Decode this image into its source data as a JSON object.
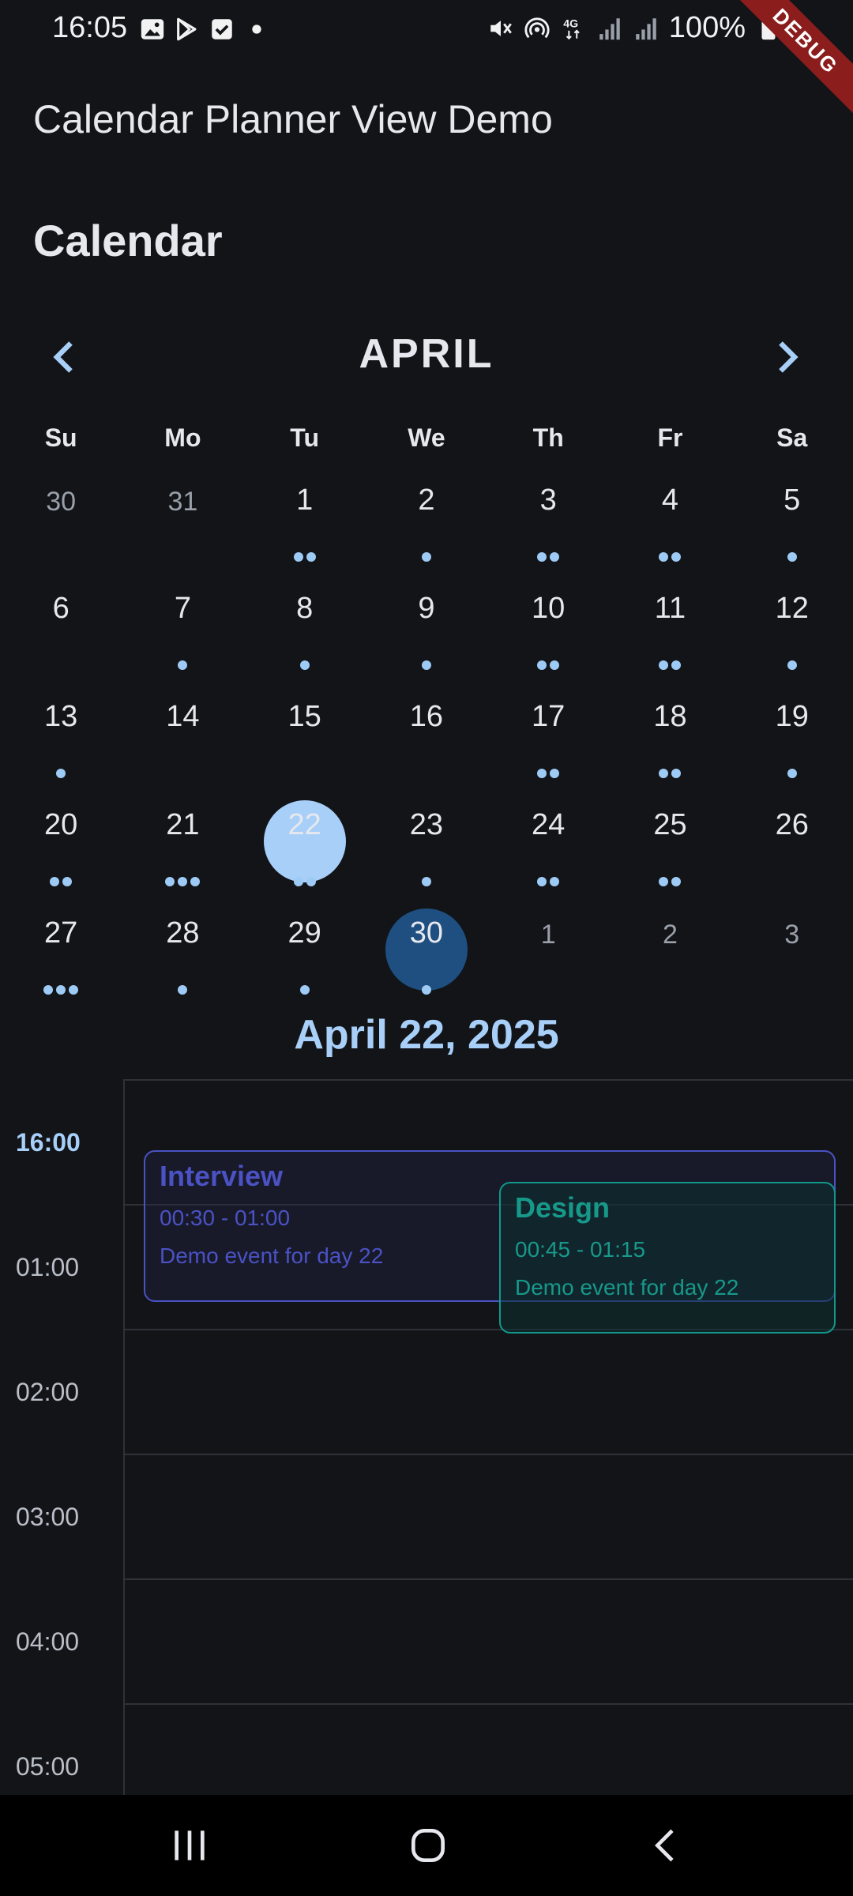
{
  "status": {
    "time": "16:05",
    "battery": "100%",
    "left_icons": [
      "gallery-icon",
      "play-store-icon",
      "checkbox-icon",
      "dot-icon"
    ],
    "right_icons": [
      "mute-icon",
      "hotspot-icon",
      "4g-icon",
      "signal-icon",
      "signal-icon",
      "battery-icon"
    ]
  },
  "debug_banner": "DEBUG",
  "app_title": "Calendar Planner View Demo",
  "section_title": "Calendar",
  "month": "APRIL",
  "weekdays": [
    "Su",
    "Mo",
    "Tu",
    "We",
    "Th",
    "Fr",
    "Sa"
  ],
  "weeks": [
    [
      {
        "n": "30",
        "muted": true,
        "dots": 0
      },
      {
        "n": "31",
        "muted": true,
        "dots": 0
      },
      {
        "n": "1",
        "dots": 2
      },
      {
        "n": "2",
        "dots": 1
      },
      {
        "n": "3",
        "dots": 2
      },
      {
        "n": "4",
        "dots": 2
      },
      {
        "n": "5",
        "dots": 1
      }
    ],
    [
      {
        "n": "6",
        "dots": 0
      },
      {
        "n": "7",
        "dots": 1
      },
      {
        "n": "8",
        "dots": 1
      },
      {
        "n": "9",
        "dots": 1
      },
      {
        "n": "10",
        "dots": 2
      },
      {
        "n": "11",
        "dots": 2
      },
      {
        "n": "12",
        "dots": 1
      }
    ],
    [
      {
        "n": "13",
        "dots": 1
      },
      {
        "n": "14",
        "dots": 0
      },
      {
        "n": "15",
        "dots": 0
      },
      {
        "n": "16",
        "dots": 0
      },
      {
        "n": "17",
        "dots": 2
      },
      {
        "n": "18",
        "dots": 2
      },
      {
        "n": "19",
        "dots": 1
      }
    ],
    [
      {
        "n": "20",
        "dots": 2
      },
      {
        "n": "21",
        "dots": 3
      },
      {
        "n": "22",
        "dots": 2,
        "selected": true
      },
      {
        "n": "23",
        "dots": 1
      },
      {
        "n": "24",
        "dots": 2
      },
      {
        "n": "25",
        "dots": 2
      },
      {
        "n": "26",
        "dots": 0
      }
    ],
    [
      {
        "n": "27",
        "dots": 3
      },
      {
        "n": "28",
        "dots": 1
      },
      {
        "n": "29",
        "dots": 1
      },
      {
        "n": "30",
        "dots": 1,
        "today": true
      },
      {
        "n": "1",
        "muted": true,
        "dots": 0
      },
      {
        "n": "2",
        "muted": true,
        "dots": 0
      },
      {
        "n": "3",
        "muted": true,
        "dots": 0
      }
    ]
  ],
  "selected_date": "April 22, 2025",
  "hours": [
    {
      "label": "16:00",
      "current": true
    },
    {
      "label": "01:00"
    },
    {
      "label": "02:00"
    },
    {
      "label": "03:00"
    },
    {
      "label": "04:00"
    },
    {
      "label": "05:00"
    }
  ],
  "events": [
    {
      "key": "interview",
      "title": "Interview",
      "time": "00:30 - 01:00",
      "desc": "Demo event for day 22",
      "color": "#4a52c4"
    },
    {
      "key": "design",
      "title": "Design",
      "time": "00:45 - 01:15",
      "desc": "Demo event for day 22",
      "color": "#17998a"
    }
  ],
  "colors": {
    "background": "#121418",
    "accent": "#a8cff8",
    "today": "#1e4f80",
    "dot": "#9ecbf6"
  }
}
